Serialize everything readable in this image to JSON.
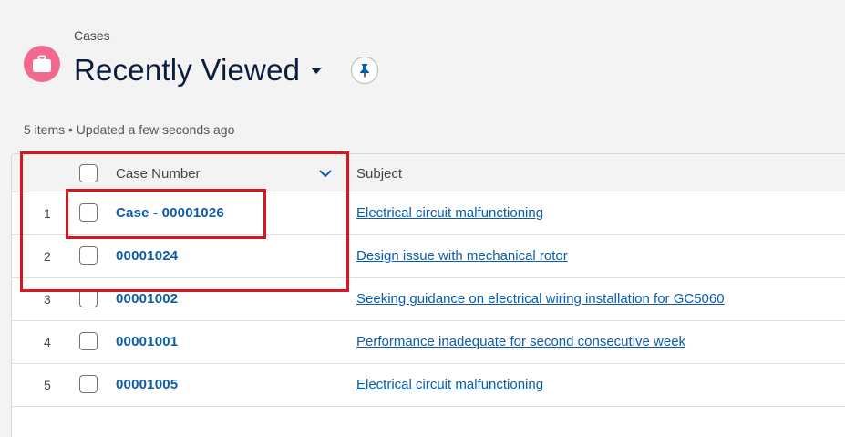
{
  "header": {
    "object_label": "Cases",
    "list_view_title": "Recently Viewed",
    "meta_text": "5 items • Updated a few seconds ago"
  },
  "table": {
    "columns": [
      "Case Number",
      "Subject"
    ],
    "rows": [
      {
        "num": "1",
        "case_number": "Case - 00001026",
        "subject": "Electrical circuit malfunctioning"
      },
      {
        "num": "2",
        "case_number": "00001024",
        "subject": "Design issue with mechanical rotor"
      },
      {
        "num": "3",
        "case_number": "00001002",
        "subject": "Seeking guidance on electrical wiring installation for GC5060"
      },
      {
        "num": "4",
        "case_number": "00001001",
        "subject": "Performance inadequate for second consecutive week"
      },
      {
        "num": "5",
        "case_number": "00001005",
        "subject": "Electrical circuit malfunctioning"
      }
    ]
  },
  "colors": {
    "icon_bg": "#f2688f",
    "link": "#0b5cab",
    "title": "#0b1d3a",
    "highlight": "#d9151e"
  },
  "icons": {
    "object": "briefcase-icon",
    "title_dropdown": "caret-down-icon",
    "pin": "pin-icon",
    "sort": "chevron-down-icon"
  }
}
